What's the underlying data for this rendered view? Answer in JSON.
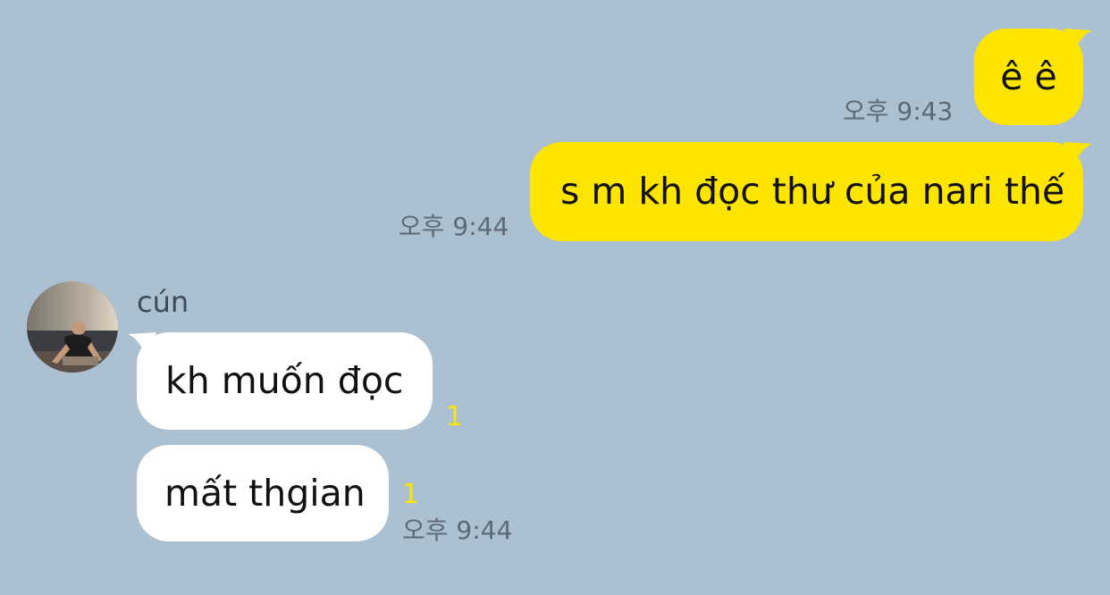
{
  "messages": {
    "out1": {
      "text": "ê ê",
      "time": "오후 9:43"
    },
    "out2": {
      "text": "s m kh đọc thư của nari thế",
      "time": "오후 9:44"
    },
    "sender_name": "cún",
    "in1": {
      "text": "kh muốn đọc",
      "unread": "1"
    },
    "in2": {
      "text": "mất thgian",
      "unread": "1",
      "time": "오후 9:44"
    }
  },
  "colors": {
    "background": "#abc1d1",
    "outgoing_bubble": "#fee500",
    "incoming_bubble": "#ffffff",
    "unread_count": "#fee500"
  },
  "icons": {
    "avatar": "user-avatar-photo"
  }
}
